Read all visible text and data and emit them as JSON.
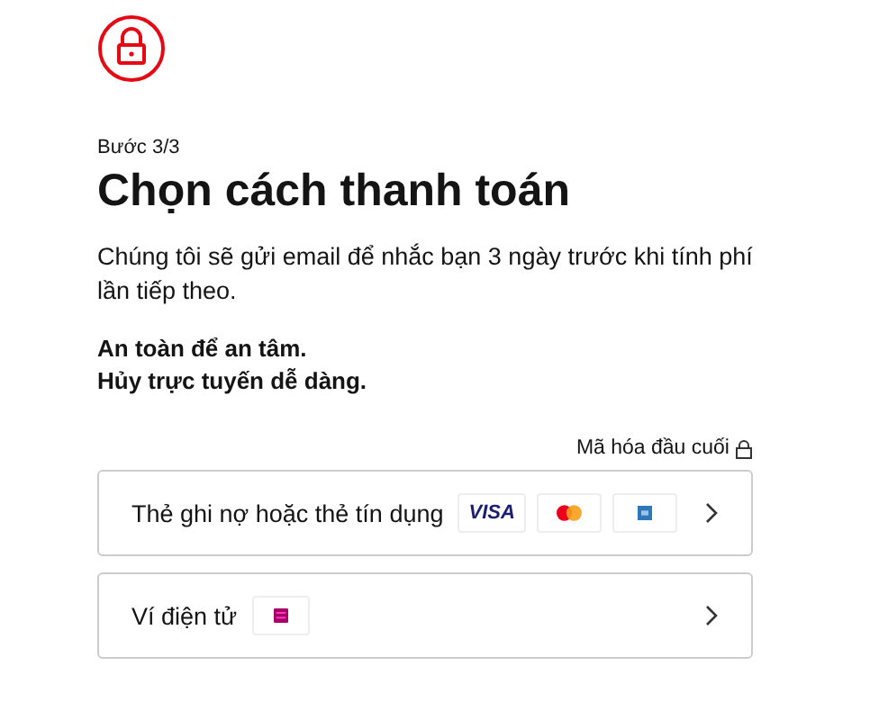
{
  "step": "Bước 3/3",
  "title": "Chọn cách thanh toán",
  "description": "Chúng tôi sẽ gửi email để nhắc bạn 3 ngày trước khi tính phí lần tiếp theo.",
  "assurances": [
    "An toàn để an tâm.",
    "Hủy trực tuyến dễ dàng."
  ],
  "encryption_note": "Mã hóa đầu cuối",
  "payment_options": [
    {
      "label": "Thẻ ghi nợ hoặc thẻ tín dụng",
      "logos": [
        {
          "kind": "visa",
          "text": "VISA"
        },
        {
          "kind": "mastercard"
        },
        {
          "kind": "amex"
        }
      ]
    },
    {
      "label": "Ví điện tử",
      "logos": [
        {
          "kind": "momo"
        }
      ]
    }
  ]
}
